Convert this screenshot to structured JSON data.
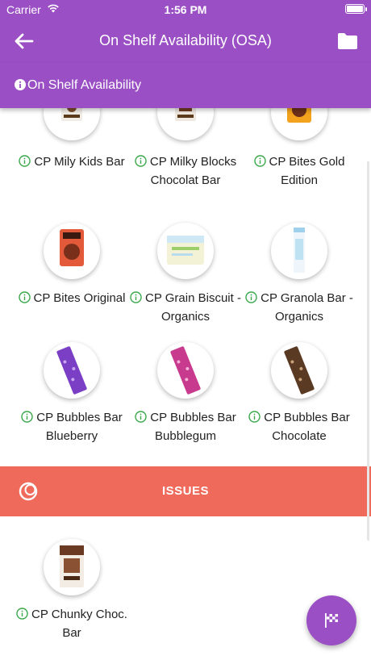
{
  "status_bar": {
    "carrier": "Carrier",
    "time": "1:56 PM"
  },
  "app_bar": {
    "title": "On Shelf Availability (OSA)"
  },
  "sub_bar": {
    "title": "On Shelf Availability"
  },
  "products": [
    {
      "name": "CP Mily Kids Bar"
    },
    {
      "name": "CP Milky Blocks Chocolat Bar"
    },
    {
      "name": "CP Bites Gold Edition"
    },
    {
      "name": "CP Bites Original"
    },
    {
      "name": "CP Grain Biscuit - Organics"
    },
    {
      "name": "CP Granola Bar - Organics"
    },
    {
      "name": "CP Bubbles Bar Blueberry"
    },
    {
      "name": "CP Bubbles Bar Bubblegum"
    },
    {
      "name": "CP Bubbles Bar Chocolate"
    }
  ],
  "issues": {
    "label": "ISSUES"
  },
  "issue_products": [
    {
      "name": "CP Chunky Choc. Bar"
    }
  ],
  "colors": {
    "primary": "#9b4fc4",
    "issues": "#ef6a5a",
    "info_green": "#3aa84a"
  },
  "icons": {
    "back": "arrow-left-icon",
    "folder": "folder-icon",
    "info": "info-icon",
    "issues": "ring-icon",
    "fab": "checkered-flag-icon"
  }
}
